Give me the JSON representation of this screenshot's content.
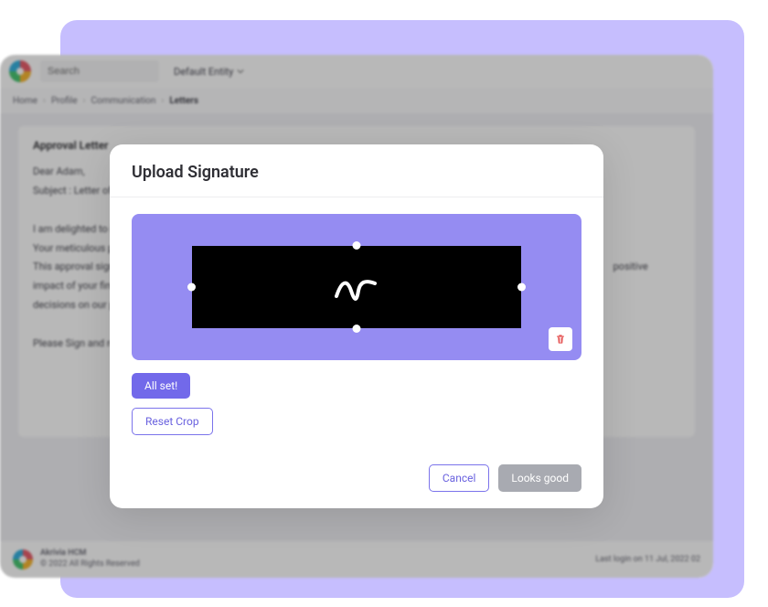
{
  "topbar": {
    "search_placeholder": "Search",
    "entity_label": "Default Entity"
  },
  "breadcrumb": {
    "items": [
      "Home",
      "Profile",
      "Communication"
    ],
    "current": "Letters"
  },
  "card": {
    "title": "Approval Letter",
    "lines": [
      "Dear Adam,",
      "Subject : Letter of lt",
      "I am delighted to in",
      "Your meticulous pl",
      "This approval signi",
      "decisions on our pr",
      "Please Sign and re"
    ],
    "trailing_fragment": "positive impact of your fina"
  },
  "footer": {
    "brand": "Akrivia HCM",
    "rights": "© 2022 All Rights Reserved",
    "last_login": "Last login on 11 Jul, 2022 02"
  },
  "modal": {
    "title": "Upload Signature",
    "all_set_label": "All set!",
    "reset_label": "Reset Crop",
    "cancel_label": "Cancel",
    "confirm_label": "Looks good"
  }
}
